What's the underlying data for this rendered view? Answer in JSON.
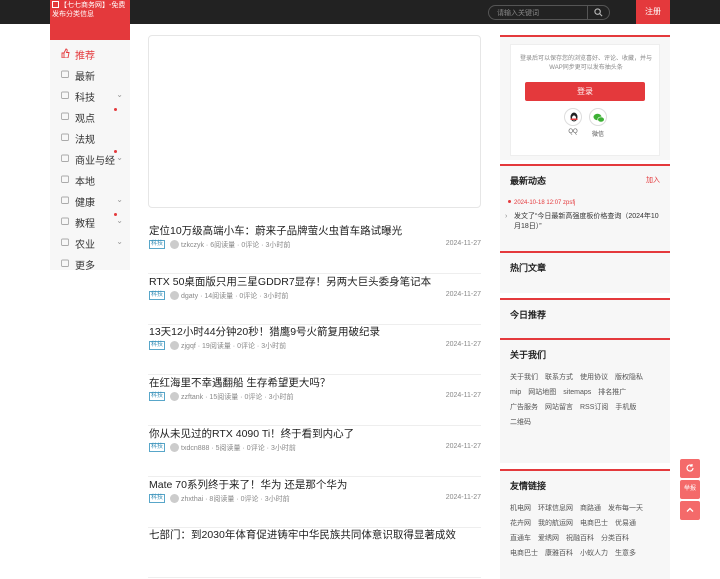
{
  "header": {
    "logo_alt": "【七七商务网】-免费发布分类信息",
    "search_placeholder": "请输入关键词",
    "register_label": "注册"
  },
  "nav": {
    "items": [
      {
        "label": "推荐",
        "icon": "thumbs-up-icon",
        "active": true,
        "chevron": false,
        "dot": false
      },
      {
        "label": "最新",
        "icon": "new-icon",
        "active": false,
        "chevron": false,
        "dot": false
      },
      {
        "label": "科技",
        "icon": "tech-icon",
        "active": false,
        "chevron": true,
        "dot": false
      },
      {
        "label": "观点",
        "icon": "opinion-icon",
        "active": false,
        "chevron": false,
        "dot": true
      },
      {
        "label": "法规",
        "icon": "law-icon",
        "active": false,
        "chevron": false,
        "dot": false
      },
      {
        "label": "商业与经",
        "icon": "business-icon",
        "active": false,
        "chevron": true,
        "dot": true
      },
      {
        "label": "本地",
        "icon": "location-icon",
        "active": false,
        "chevron": false,
        "dot": false
      },
      {
        "label": "健康",
        "icon": "health-icon",
        "active": false,
        "chevron": true,
        "dot": false
      },
      {
        "label": "教程",
        "icon": "tutorial-icon",
        "active": false,
        "chevron": true,
        "dot": true
      },
      {
        "label": "农业",
        "icon": "agriculture-icon",
        "active": false,
        "chevron": true,
        "dot": false
      },
      {
        "label": "更多",
        "icon": "more-icon",
        "active": false,
        "chevron": false,
        "dot": false
      }
    ]
  },
  "articles": [
    {
      "title": "定位10万级高端小车：蔚来子品牌萤火虫首车路试曝光",
      "tag": "科技",
      "author": "tzkczyk",
      "reads": "6阅读量",
      "comments": "0评论",
      "ago": "3小时前",
      "date": "2024-11-27"
    },
    {
      "title": "RTX 50桌面版只用三星GDDR7显存！另两大巨头委身笔记本",
      "tag": "科技",
      "author": "dgaty",
      "reads": "14阅读量",
      "comments": "0评论",
      "ago": "3小时前",
      "date": "2024-11-27"
    },
    {
      "title": "13天12小时44分钟20秒！猎鹰9号火箭复用破纪录",
      "tag": "科技",
      "author": "zjgqf",
      "reads": "19阅读量",
      "comments": "0评论",
      "ago": "3小时前",
      "date": "2024-11-27"
    },
    {
      "title": "在红海里不幸遇翻船 生存希望更大吗？",
      "tag": "科技",
      "author": "zzftank",
      "reads": "15阅读量",
      "comments": "0评论",
      "ago": "3小时前",
      "date": "2024-11-27"
    },
    {
      "title": "你从未见过的RTX 4090 Ti！终于看到内心了",
      "tag": "科技",
      "author": "txdcn888",
      "reads": "5阅读量",
      "comments": "0评论",
      "ago": "3小时前",
      "date": "2024-11-27"
    },
    {
      "title": "Mate 70系列终于来了！华为 还是那个华为",
      "tag": "科技",
      "author": "zhxthai",
      "reads": "8阅读量",
      "comments": "0评论",
      "ago": "3小时前",
      "date": "2024-11-27"
    },
    {
      "title": "七部门：到2030年体育促进铸牢中华民族共同体意识取得显著成效",
      "tag": "",
      "author": "",
      "reads": "",
      "comments": "",
      "ago": "",
      "date": ""
    }
  ],
  "login": {
    "hint": "登录后可以保存您的浏览喜好、评论、收藏，并与WAP同步更可以发布抽头条",
    "button": "登录",
    "qq_label": "QQ",
    "wechat_label": "微信"
  },
  "dynamics": {
    "title": "最新动态",
    "join": "加入",
    "date": "2024-10-18 12:07 zpsfj",
    "text": "发文了“今日最新高强度板价格查询（2024年10月18日）”"
  },
  "hot": {
    "title": "热门文章"
  },
  "today": {
    "title": "今日推荐"
  },
  "about": {
    "title": "关于我们",
    "links": [
      "关于我们",
      "联系方式",
      "使用协议",
      "版权隐私",
      "mip",
      "网站地图",
      "sitemaps",
      "排名推广",
      "广告服务",
      "网站留言",
      "RSS订阅",
      "手机版",
      "二维码"
    ]
  },
  "friends": {
    "title": "友情链接",
    "links": [
      "机电网",
      "环球信息网",
      "商路通",
      "发布每一天",
      "花卉网",
      "我的航运网",
      "电商巴士",
      "优易通",
      "直通车",
      "爱绣网",
      "祝融百科",
      "分类百科",
      "电商巴士",
      "康雅百科",
      "小蚁人力",
      "生意多"
    ]
  },
  "float_buttons": {
    "report": "举报"
  }
}
